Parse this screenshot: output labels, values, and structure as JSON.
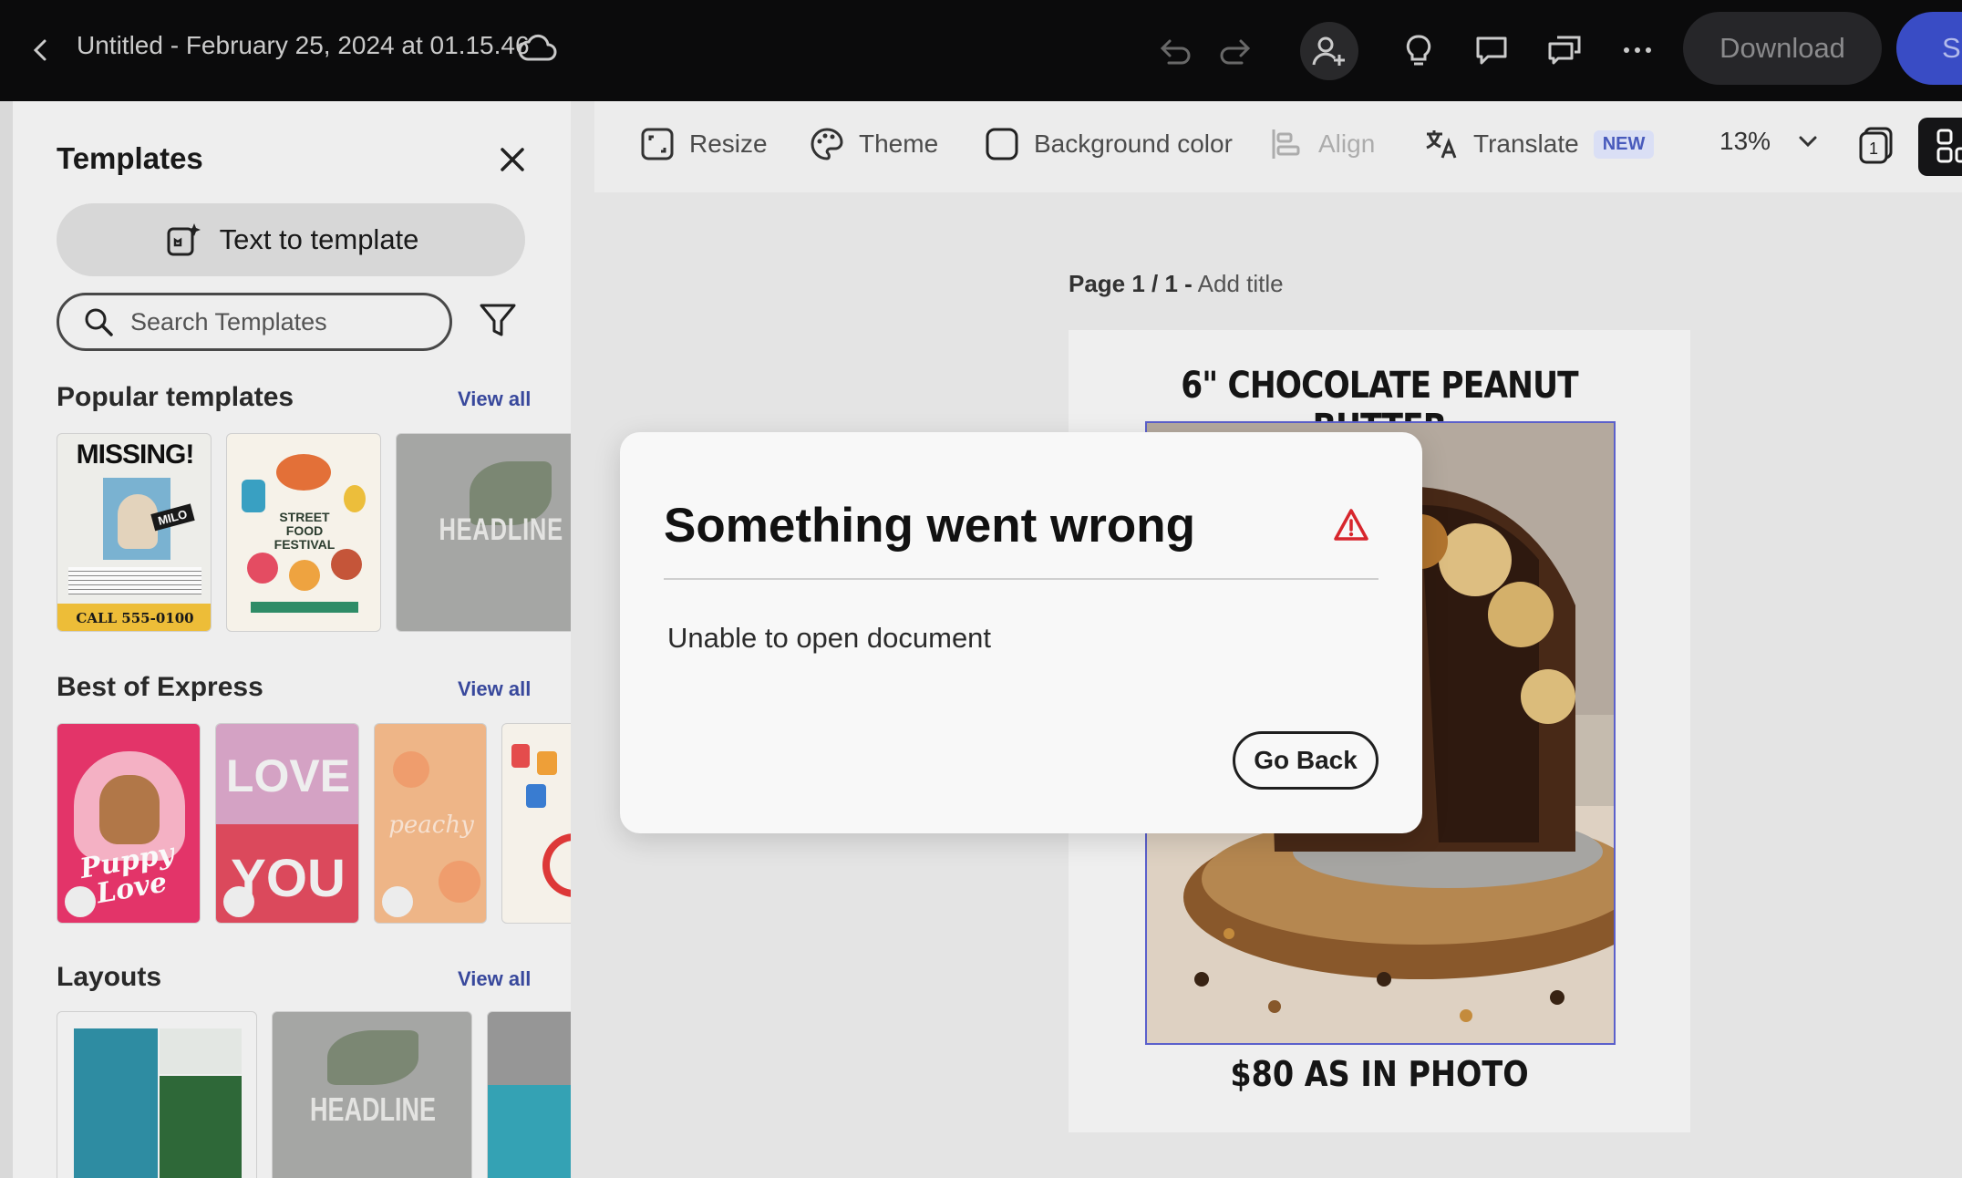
{
  "topbar": {
    "doc_title": "Untitled - February 25, 2024 at 01.15.46",
    "download_label": "Download",
    "share_label": "Sh"
  },
  "panel": {
    "title": "Templates",
    "text_to_template": "Text to template",
    "search_placeholder": "Search Templates",
    "sections": {
      "popular": "Popular templates",
      "best": "Best of Express",
      "layouts": "Layouts",
      "view_all": "View all"
    },
    "thumbs": {
      "missing_title": "MISSING!",
      "missing_name": "MILO",
      "missing_phone": "CALL 555-0100",
      "street_food": "STREET FOOD FESTIVAL",
      "headline": "HEADLINE",
      "love_top": "LOVE",
      "love_bottom": "YOU",
      "puppy": "Puppy Love",
      "peachy": "peachy"
    }
  },
  "toolbar": {
    "resize": "Resize",
    "theme": "Theme",
    "background_color": "Background color",
    "align": "Align",
    "translate": "Translate",
    "new_badge": "NEW",
    "zoom": "13%",
    "page_count": "1"
  },
  "canvas": {
    "page_label_bold": "Page 1 / 1 -",
    "page_label_title": "Add title",
    "heading": "6\" CHOCOLATE PEANUT BUTTER",
    "price": "$80 AS IN PHOTO"
  },
  "dialog": {
    "title": "Something went wrong",
    "body": "Unable to open document",
    "go_back": "Go Back"
  },
  "colors": {
    "topbar_bg": "#0c0c0d",
    "share_accent": "#3b4ec9",
    "warning_red": "#d7262d",
    "view_all_link": "#3a4aa0"
  }
}
